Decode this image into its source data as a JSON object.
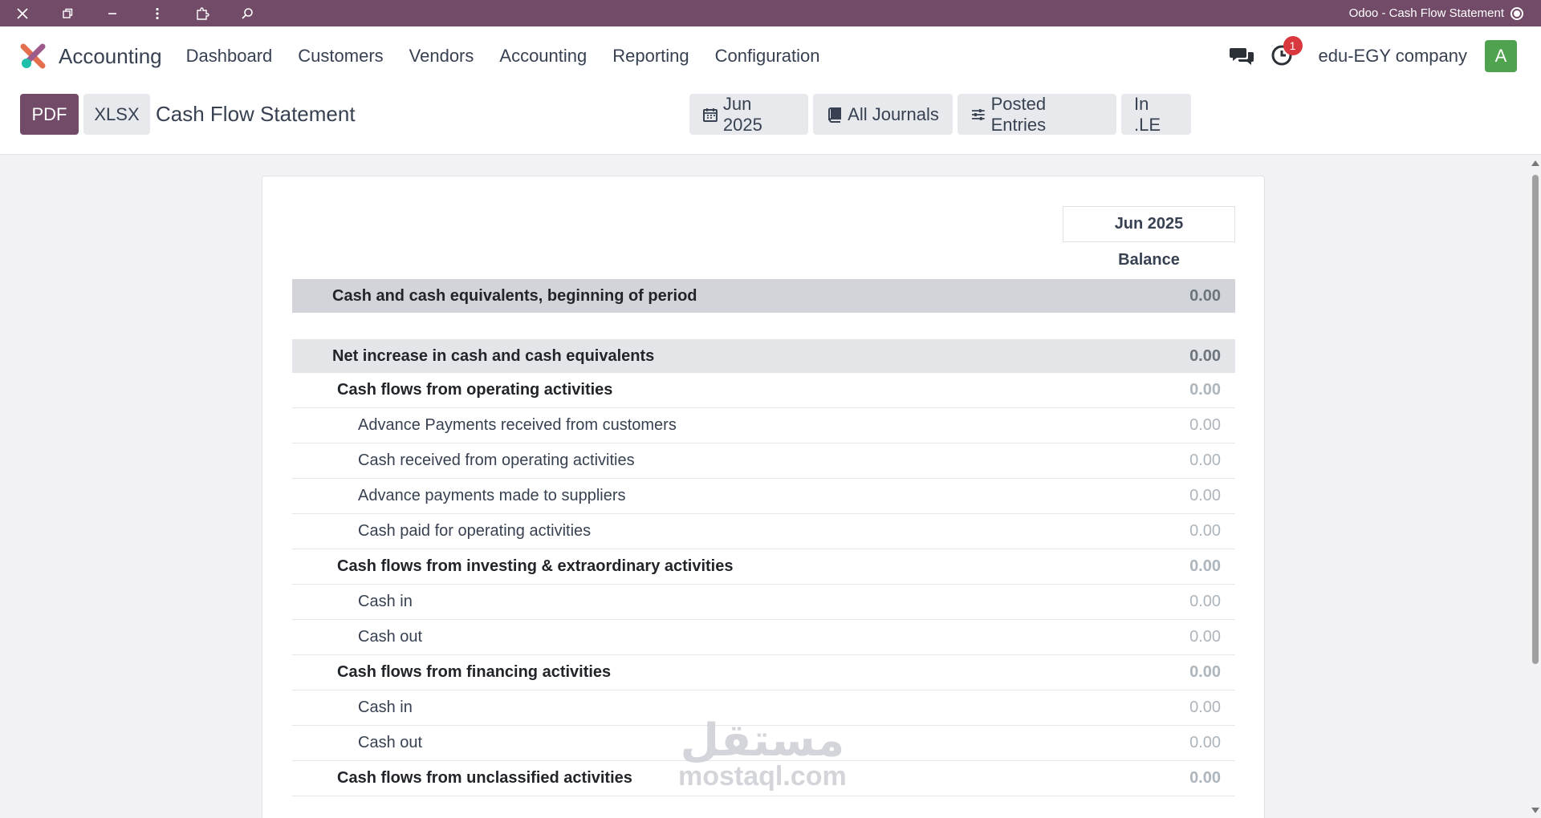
{
  "window": {
    "title": "Odoo - Cash Flow Statement"
  },
  "navbar": {
    "app_name": "Accounting",
    "menu": [
      "Dashboard",
      "Customers",
      "Vendors",
      "Accounting",
      "Reporting",
      "Configuration"
    ],
    "activity_count": "1",
    "company": "edu-EGY company",
    "avatar_letter": "A"
  },
  "control_panel": {
    "pdf_label": "PDF",
    "xlsx_label": "XLSX",
    "title": "Cash Flow Statement",
    "filters": {
      "date": "Jun 2025",
      "journals": "All Journals",
      "posted": "Posted Entries",
      "currency": "In .LE"
    }
  },
  "report": {
    "column_period": "Jun 2025",
    "column_label": "Balance",
    "rows": [
      {
        "label": "Cash and cash equivalents, beginning of period",
        "value": "0.00",
        "level": "total"
      },
      {
        "label": "Net increase in cash and cash equivalents",
        "value": "0.00",
        "level": "total"
      },
      {
        "label": "Cash flows from operating activities",
        "value": "0.00",
        "level": "1"
      },
      {
        "label": "Advance Payments received from customers",
        "value": "0.00",
        "level": "2"
      },
      {
        "label": "Cash received from operating activities",
        "value": "0.00",
        "level": "2"
      },
      {
        "label": "Advance payments made to suppliers",
        "value": "0.00",
        "level": "2"
      },
      {
        "label": "Cash paid for operating activities",
        "value": "0.00",
        "level": "2"
      },
      {
        "label": "Cash flows from investing & extraordinary activities",
        "value": "0.00",
        "level": "1"
      },
      {
        "label": "Cash in",
        "value": "0.00",
        "level": "2"
      },
      {
        "label": "Cash out",
        "value": "0.00",
        "level": "2"
      },
      {
        "label": "Cash flows from financing activities",
        "value": "0.00",
        "level": "1"
      },
      {
        "label": "Cash in",
        "value": "0.00",
        "level": "2"
      },
      {
        "label": "Cash out",
        "value": "0.00",
        "level": "2"
      },
      {
        "label": "Cash flows from unclassified activities",
        "value": "0.00",
        "level": "1"
      }
    ]
  },
  "watermark": {
    "arabic": "مستقل",
    "latin": "mostaql.com"
  },
  "colors": {
    "brand": "#714b67",
    "badge": "#d9383e",
    "avatar": "#4fa34f"
  }
}
